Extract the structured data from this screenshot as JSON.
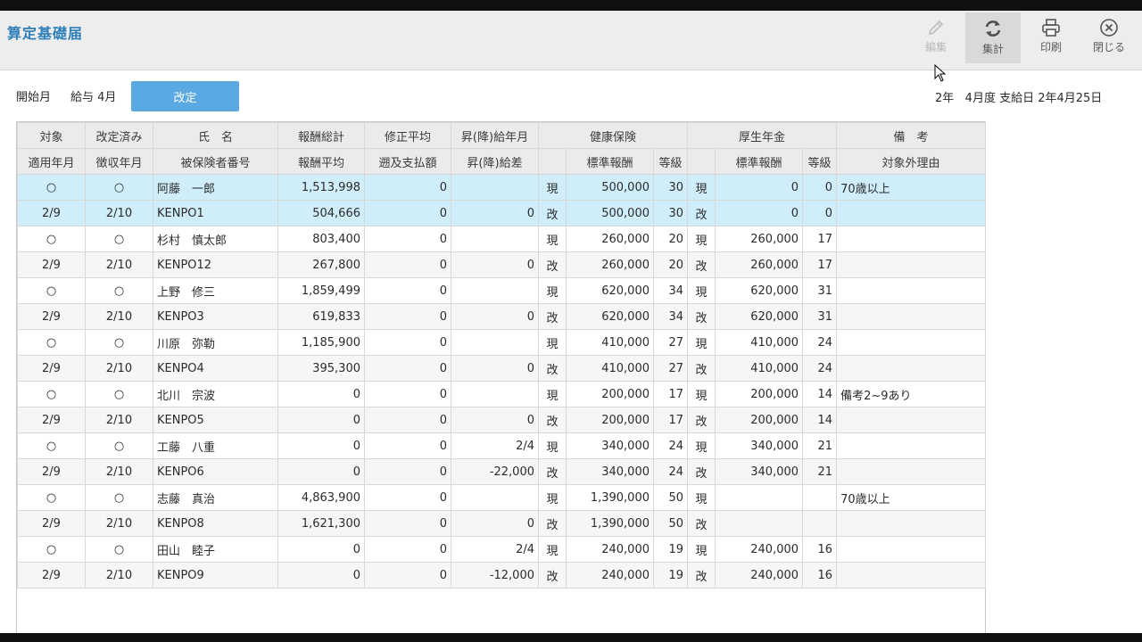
{
  "header": {
    "title": "算定基礎届",
    "toolbar": {
      "edit_label": "編集",
      "aggregate_label": "集計",
      "print_label": "印刷",
      "close_label": "閉じる"
    }
  },
  "info": {
    "start_label": "開始月",
    "start_value": "給与 4月",
    "revise_label": "改定",
    "period_text": "2年   4月度 支給日 2年4月25日"
  },
  "table": {
    "headers_top": [
      "対象",
      "改定済み",
      "氏　名",
      "報酬総計",
      "修正平均",
      "昇(降)給年月",
      "健康保険",
      "厚生年金",
      "備　考"
    ],
    "headers_bottom": [
      "適用年月",
      "徴収年月",
      "被保険者番号",
      "報酬平均",
      "遡及支払額",
      "昇(降)給差",
      "標準報酬",
      "等級",
      "標準報酬",
      "等級",
      "対象外理由"
    ],
    "rows": [
      {
        "a": {
          "target": "○",
          "revised": "○",
          "name": "阿藤　一郎",
          "total": "1,513,998",
          "adj_avg": "0",
          "raise_ym": "",
          "h_mark": "現",
          "h_std": "500,000",
          "h_grade": "30",
          "p_mark": "現",
          "p_std": "0",
          "p_grade": "0",
          "remarks": "70歳以上"
        },
        "b": {
          "apply_ym": "2/9",
          "collect_ym": "2/10",
          "ins_no": "KENPO1",
          "avg": "504,666",
          "retro": "0",
          "raise_diff": "0",
          "h_mark": "改",
          "h_std": "500,000",
          "h_grade": "30",
          "p_mark": "改",
          "p_std": "0",
          "p_grade": "0",
          "reason": ""
        }
      },
      {
        "a": {
          "target": "○",
          "revised": "○",
          "name": "杉村　慎太郎",
          "total": "803,400",
          "adj_avg": "0",
          "raise_ym": "",
          "h_mark": "現",
          "h_std": "260,000",
          "h_grade": "20",
          "p_mark": "現",
          "p_std": "260,000",
          "p_grade": "17",
          "remarks": ""
        },
        "b": {
          "apply_ym": "2/9",
          "collect_ym": "2/10",
          "ins_no": "KENPO12",
          "avg": "267,800",
          "retro": "0",
          "raise_diff": "0",
          "h_mark": "改",
          "h_std": "260,000",
          "h_grade": "20",
          "p_mark": "改",
          "p_std": "260,000",
          "p_grade": "17",
          "reason": ""
        }
      },
      {
        "a": {
          "target": "○",
          "revised": "○",
          "name": "上野　修三",
          "total": "1,859,499",
          "adj_avg": "0",
          "raise_ym": "",
          "h_mark": "現",
          "h_std": "620,000",
          "h_grade": "34",
          "p_mark": "現",
          "p_std": "620,000",
          "p_grade": "31",
          "remarks": ""
        },
        "b": {
          "apply_ym": "2/9",
          "collect_ym": "2/10",
          "ins_no": "KENPO3",
          "avg": "619,833",
          "retro": "0",
          "raise_diff": "0",
          "h_mark": "改",
          "h_std": "620,000",
          "h_grade": "34",
          "p_mark": "改",
          "p_std": "620,000",
          "p_grade": "31",
          "reason": ""
        }
      },
      {
        "a": {
          "target": "○",
          "revised": "○",
          "name": "川原　弥勒",
          "total": "1,185,900",
          "adj_avg": "0",
          "raise_ym": "",
          "h_mark": "現",
          "h_std": "410,000",
          "h_grade": "27",
          "p_mark": "現",
          "p_std": "410,000",
          "p_grade": "24",
          "remarks": ""
        },
        "b": {
          "apply_ym": "2/9",
          "collect_ym": "2/10",
          "ins_no": "KENPO4",
          "avg": "395,300",
          "retro": "0",
          "raise_diff": "0",
          "h_mark": "改",
          "h_std": "410,000",
          "h_grade": "27",
          "p_mark": "改",
          "p_std": "410,000",
          "p_grade": "24",
          "reason": ""
        }
      },
      {
        "a": {
          "target": "○",
          "revised": "○",
          "name": "北川　宗波",
          "total": "0",
          "adj_avg": "0",
          "raise_ym": "",
          "h_mark": "現",
          "h_std": "200,000",
          "h_grade": "17",
          "p_mark": "現",
          "p_std": "200,000",
          "p_grade": "14",
          "remarks": "備考2~9あり"
        },
        "b": {
          "apply_ym": "2/9",
          "collect_ym": "2/10",
          "ins_no": "KENPO5",
          "avg": "0",
          "retro": "0",
          "raise_diff": "0",
          "h_mark": "改",
          "h_std": "200,000",
          "h_grade": "17",
          "p_mark": "改",
          "p_std": "200,000",
          "p_grade": "14",
          "reason": ""
        }
      },
      {
        "a": {
          "target": "○",
          "revised": "○",
          "name": "工藤　八重",
          "total": "0",
          "adj_avg": "0",
          "raise_ym": "2/4",
          "h_mark": "現",
          "h_std": "340,000",
          "h_grade": "24",
          "p_mark": "現",
          "p_std": "340,000",
          "p_grade": "21",
          "remarks": ""
        },
        "b": {
          "apply_ym": "2/9",
          "collect_ym": "2/10",
          "ins_no": "KENPO6",
          "avg": "0",
          "retro": "0",
          "raise_diff": "-22,000",
          "h_mark": "改",
          "h_std": "340,000",
          "h_grade": "24",
          "p_mark": "改",
          "p_std": "340,000",
          "p_grade": "21",
          "reason": ""
        }
      },
      {
        "a": {
          "target": "○",
          "revised": "○",
          "name": "志藤　真治",
          "total": "4,863,900",
          "adj_avg": "0",
          "raise_ym": "",
          "h_mark": "現",
          "h_std": "1,390,000",
          "h_grade": "50",
          "p_mark": "現",
          "p_std": "",
          "p_grade": "",
          "remarks": "70歳以上"
        },
        "b": {
          "apply_ym": "2/9",
          "collect_ym": "2/10",
          "ins_no": "KENPO8",
          "avg": "1,621,300",
          "retro": "0",
          "raise_diff": "0",
          "h_mark": "改",
          "h_std": "1,390,000",
          "h_grade": "50",
          "p_mark": "改",
          "p_std": "",
          "p_grade": "",
          "reason": ""
        }
      },
      {
        "a": {
          "target": "○",
          "revised": "○",
          "name": "田山　睦子",
          "total": "0",
          "adj_avg": "0",
          "raise_ym": "2/4",
          "h_mark": "現",
          "h_std": "240,000",
          "h_grade": "19",
          "p_mark": "現",
          "p_std": "240,000",
          "p_grade": "16",
          "remarks": ""
        },
        "b": {
          "apply_ym": "2/9",
          "collect_ym": "2/10",
          "ins_no": "KENPO9",
          "avg": "0",
          "retro": "0",
          "raise_diff": "-12,000",
          "h_mark": "改",
          "h_std": "240,000",
          "h_grade": "19",
          "p_mark": "改",
          "p_std": "240,000",
          "p_grade": "16",
          "reason": ""
        }
      }
    ]
  }
}
